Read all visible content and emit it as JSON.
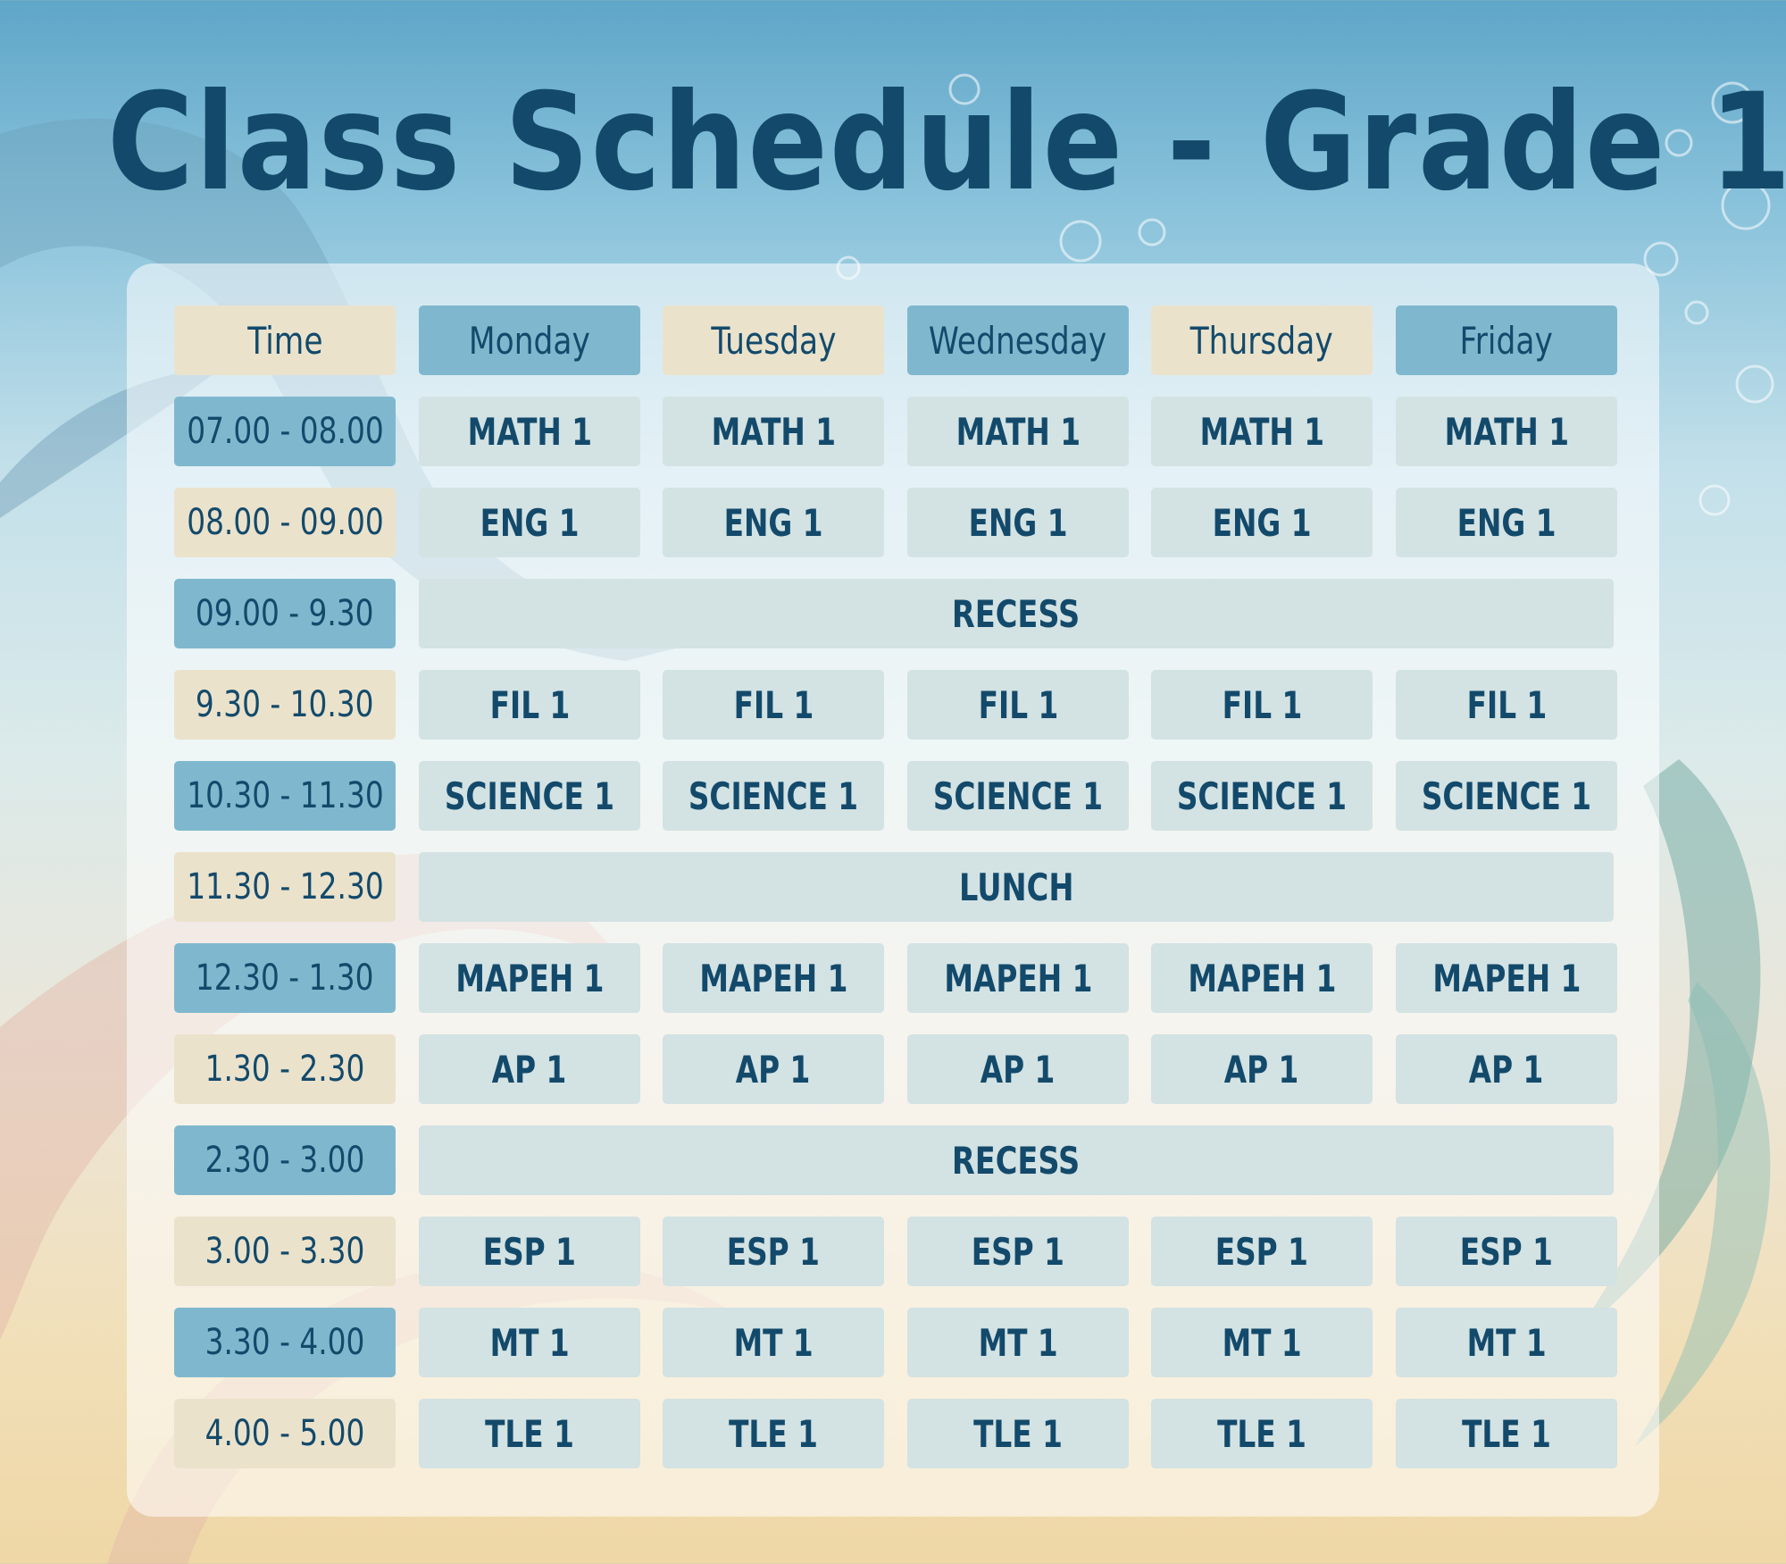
{
  "title": "Class Schedule - Grade 1",
  "colors": {
    "title": "#134a6b",
    "header_blue": "#7fb8ce",
    "header_beige": "#ebe2cc",
    "cell": "#d3e2e3"
  },
  "headers": [
    "Time",
    "Monday",
    "Tuesday",
    "Wednesday",
    "Thursday",
    "Friday"
  ],
  "rows": [
    {
      "time": "07.00 - 08.00",
      "cells": [
        "MATH 1",
        "MATH 1",
        "MATH 1",
        "MATH 1",
        "MATH 1"
      ]
    },
    {
      "time": "08.00 - 09.00",
      "cells": [
        "ENG 1",
        "ENG 1",
        "ENG 1",
        "ENG 1",
        "ENG 1"
      ]
    },
    {
      "time": "09.00 - 9.30",
      "span": "RECESS"
    },
    {
      "time": "9.30 - 10.30",
      "cells": [
        "FIL 1",
        "FIL 1",
        "FIL 1",
        "FIL 1",
        "FIL 1"
      ]
    },
    {
      "time": "10.30 - 11.30",
      "cells": [
        "SCIENCE 1",
        "SCIENCE 1",
        "SCIENCE 1",
        "SCIENCE 1",
        "SCIENCE 1"
      ]
    },
    {
      "time": "11.30 - 12.30",
      "span": "LUNCH"
    },
    {
      "time": "12.30 - 1.30",
      "cells": [
        "MAPEH 1",
        "MAPEH 1",
        "MAPEH 1",
        "MAPEH 1",
        "MAPEH 1"
      ]
    },
    {
      "time": "1.30 - 2.30",
      "cells": [
        "AP 1",
        "AP 1",
        "AP 1",
        "AP 1",
        "AP 1"
      ]
    },
    {
      "time": "2.30 - 3.00",
      "span": "RECESS"
    },
    {
      "time": "3.00 - 3.30",
      "cells": [
        "ESP 1",
        "ESP 1",
        "ESP 1",
        "ESP 1",
        "ESP 1"
      ]
    },
    {
      "time": "3.30 - 4.00",
      "cells": [
        "MT 1",
        "MT 1",
        "MT 1",
        "MT 1",
        "MT 1"
      ]
    },
    {
      "time": "4.00 - 5.00",
      "cells": [
        "TLE 1",
        "TLE 1",
        "TLE 1",
        "TLE 1",
        "TLE 1"
      ]
    }
  ]
}
